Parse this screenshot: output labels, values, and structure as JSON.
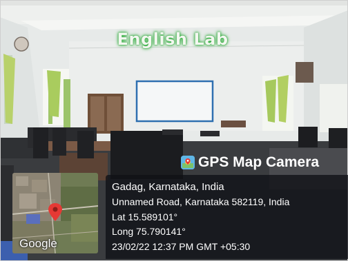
{
  "sign": {
    "text": "English  Lab"
  },
  "badge": {
    "title": "GPS Map Camera",
    "icon": "gps-map-camera-app-icon"
  },
  "map": {
    "logo_text": "Google",
    "pin_icon": "map-pin-icon"
  },
  "info": {
    "location": "Gadag, Karnataka, India",
    "address": "Unnamed Road, Karnataka 582119, India",
    "lat": "Lat 15.589101°",
    "long": "Long 75.790141°",
    "datetime": "23/02/22 12:37 PM GMT +05:30"
  },
  "colors": {
    "sign_glow": "#2fae3c",
    "pin": "#e53935",
    "panel": "#0f1116"
  }
}
